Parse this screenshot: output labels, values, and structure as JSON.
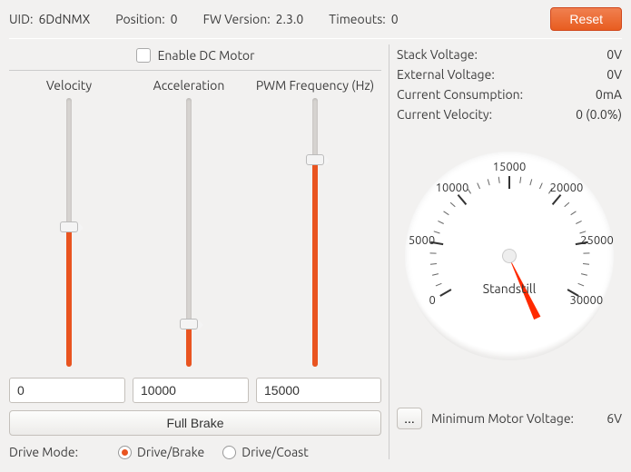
{
  "header": {
    "uid_label": "UID:",
    "uid_value": "6DdNMX",
    "position_label": "Position:",
    "position_value": "0",
    "fw_label": "FW Version:",
    "fw_value": "2.3.0",
    "timeouts_label": "Timeouts:",
    "timeouts_value": "0",
    "reset_label": "Reset"
  },
  "enable": {
    "label": "Enable DC Motor",
    "checked": false
  },
  "sliders": {
    "velocity": {
      "label": "Velocity",
      "value": "0",
      "fill_pct": 50
    },
    "acceleration": {
      "label": "Acceleration",
      "value": "10000",
      "fill_pct": 14
    },
    "pwm": {
      "label": "PWM Frequency (Hz)",
      "value": "15000",
      "fill_pct": 75
    }
  },
  "full_brake_label": "Full Brake",
  "drive_mode": {
    "label": "Drive Mode:",
    "option1": "Drive/Brake",
    "option2": "Drive/Coast",
    "selected": 1
  },
  "stats": {
    "stack_voltage": {
      "label": "Stack Voltage:",
      "value": "0V"
    },
    "external_voltage": {
      "label": "External Voltage:",
      "value": "0V"
    },
    "current_consumption": {
      "label": "Current Consumption:",
      "value": "0mA"
    },
    "current_velocity": {
      "label": "Current Velocity:",
      "value": "0 (0.0%)"
    }
  },
  "gauge": {
    "labels": [
      "0",
      "5000",
      "10000",
      "15000",
      "20000",
      "25000",
      "30000"
    ],
    "center_text": "Standstill"
  },
  "min_voltage": {
    "dots": "...",
    "label": "Minimum Motor Voltage:",
    "value": "6V"
  }
}
